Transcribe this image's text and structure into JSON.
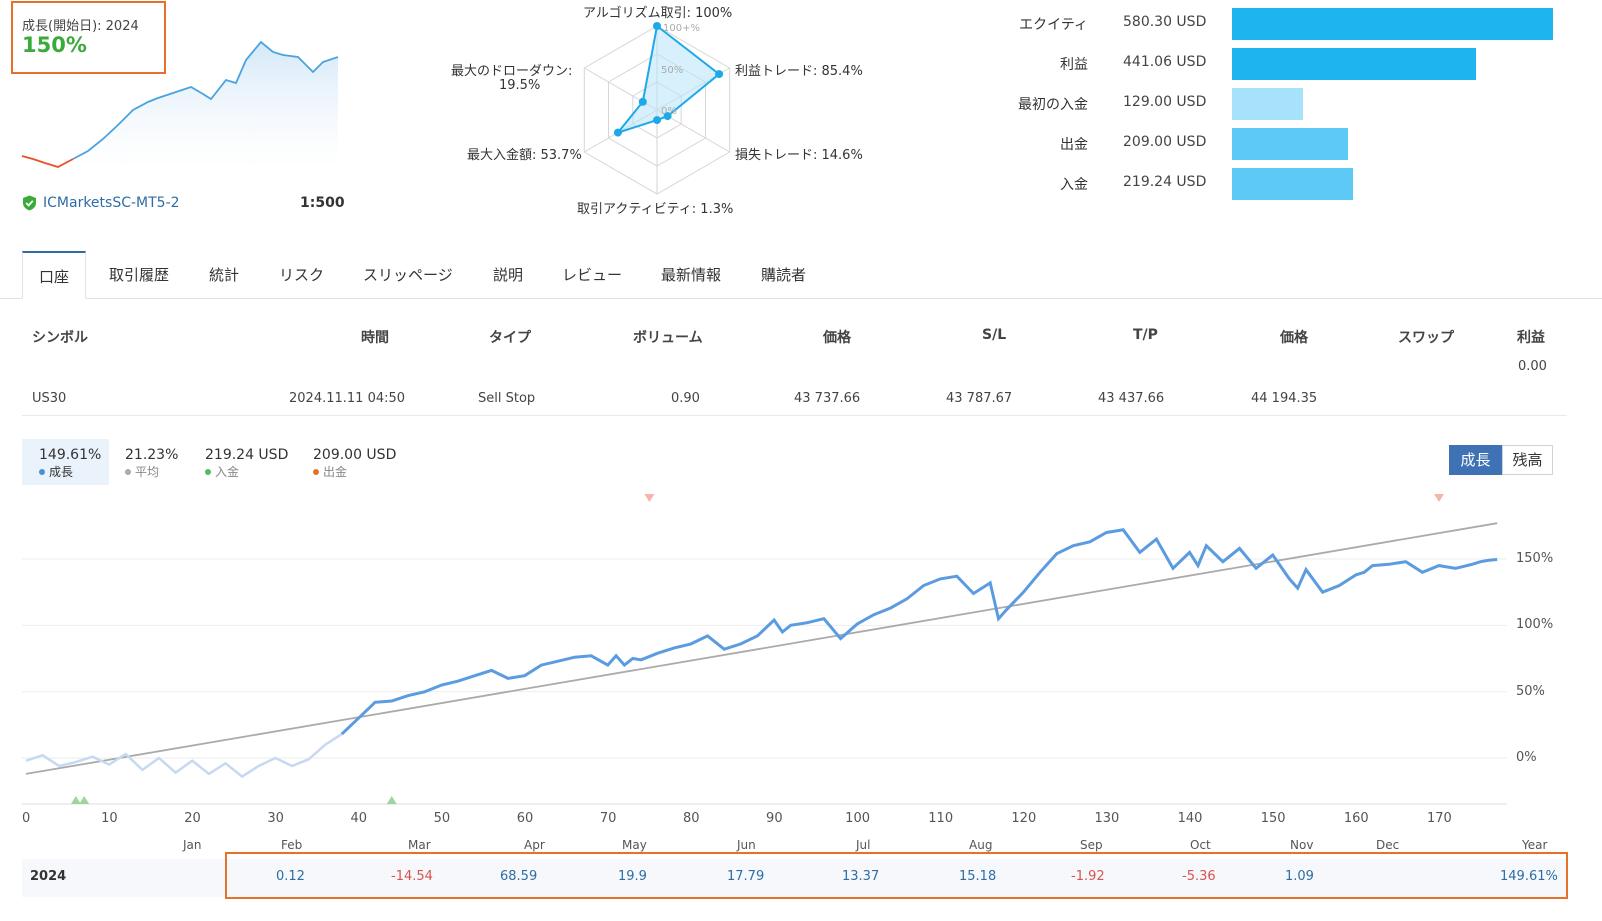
{
  "growth": {
    "label": "成長(開始日): 2024",
    "value": "150%"
  },
  "account": {
    "broker": "ICMarketsSC-MT5-2",
    "leverage": "1:500"
  },
  "radar": {
    "labels": {
      "algo": "アルゴリズム取引: 100%",
      "profit_trades": "利益トレード: 85.4%",
      "loss_trades": "損失トレード: 14.6%",
      "activity": "取引アクティビティ: 1.3%",
      "max_deposit": "最大入金額: 53.7%",
      "drawdown": "最大のドローダウン:",
      "drawdown_value": "19.5%"
    },
    "rings": [
      "100+%",
      "50%",
      "0%"
    ],
    "values": {
      "algo": 100,
      "profit_trades": 85.4,
      "loss_trades": 14.6,
      "activity": 1.3,
      "max_deposit": 53.7,
      "drawdown": 19.5
    }
  },
  "financials": [
    {
      "label": "エクイティ",
      "value": "580.30 USD",
      "amount": 580.3,
      "color": "#1db4ef"
    },
    {
      "label": "利益",
      "value": "441.06 USD",
      "amount": 441.06,
      "color": "#1db4ef"
    },
    {
      "label": "最初の入金",
      "value": "129.00 USD",
      "amount": 129.0,
      "color": "#a6e2f9"
    },
    {
      "label": "出金",
      "value": "209.00 USD",
      "amount": 209.0,
      "color": "#5ccaf4"
    },
    {
      "label": "入金",
      "value": "219.24 USD",
      "amount": 219.24,
      "color": "#5ccaf4"
    }
  ],
  "tabs": [
    "口座",
    "取引履歴",
    "統計",
    "リスク",
    "スリッページ",
    "説明",
    "レビュー",
    "最新情報",
    "購読者"
  ],
  "table": {
    "headers": [
      "シンボル",
      "時間",
      "タイプ",
      "ボリューム",
      "価格",
      "S/L",
      "T/P",
      "価格",
      "スワップ",
      "利益"
    ],
    "total_profit": "0.00",
    "row": [
      "US30",
      "2024.11.11 04:50",
      "Sell Stop",
      "0.90",
      "43 737.66",
      "43 787.67",
      "43 437.66",
      "44 194.35"
    ]
  },
  "legend": [
    {
      "value": "149.61%",
      "label": "成長",
      "color": "#4a90d9"
    },
    {
      "value": "21.23%",
      "label": "平均",
      "color": "#aaaaaa"
    },
    {
      "value": "219.24 USD",
      "label": "入金",
      "color": "#5cb85c"
    },
    {
      "value": "209.00 USD",
      "label": "出金",
      "color": "#e8712a"
    }
  ],
  "toggle": {
    "growth": "成長",
    "balance": "残高"
  },
  "chart_data": {
    "type": "line",
    "x_ticks": [
      0,
      10,
      20,
      30,
      40,
      50,
      60,
      70,
      80,
      90,
      100,
      110,
      120,
      130,
      140,
      150,
      160,
      170
    ],
    "y_ticks": [
      "150%",
      "100%",
      "50%",
      "0%"
    ],
    "xlim": [
      0,
      177
    ],
    "ylim": [
      -35,
      195
    ],
    "growth": {
      "x": [
        0,
        2,
        4,
        6,
        8,
        10,
        12,
        14,
        16,
        18,
        20,
        22,
        24,
        26,
        28,
        30,
        32,
        34,
        36,
        38,
        40,
        42,
        44,
        46,
        48,
        50,
        52,
        54,
        56,
        58,
        60,
        62,
        64,
        66,
        68,
        70,
        71,
        72,
        73,
        74,
        76,
        78,
        80,
        82,
        84,
        86,
        88,
        90,
        91,
        92,
        94,
        96,
        98,
        100,
        102,
        104,
        106,
        108,
        110,
        112,
        114,
        116,
        117,
        118,
        120,
        122,
        124,
        126,
        128,
        130,
        132,
        134,
        136,
        138,
        140,
        141,
        142,
        144,
        146,
        148,
        150,
        152,
        153,
        154,
        156,
        158,
        160,
        161,
        162,
        164,
        166,
        168,
        170,
        172,
        174,
        175,
        176,
        177
      ],
      "y": [
        -2,
        2,
        -6,
        -3,
        1,
        -5,
        3,
        -9,
        0,
        -11,
        -2,
        -12,
        -4,
        -14,
        -6,
        0,
        -6,
        -1,
        10,
        18,
        30,
        42,
        43,
        47,
        50,
        55,
        58,
        62,
        66,
        60,
        62,
        70,
        73,
        76,
        77,
        70,
        77,
        70,
        75,
        74,
        79,
        83,
        86,
        92,
        82,
        86,
        92,
        104,
        95,
        100,
        102,
        105,
        90,
        101,
        108,
        113,
        120,
        130,
        135,
        137,
        124,
        132,
        105,
        112,
        125,
        140,
        154,
        160,
        163,
        170,
        172,
        155,
        165,
        143,
        155,
        145,
        160,
        148,
        158,
        143,
        153,
        135,
        128,
        142,
        125,
        130,
        138,
        140,
        145,
        146,
        148,
        140,
        145,
        143,
        146,
        148,
        149,
        149.61
      ]
    },
    "trend": {
      "x": [
        0,
        177
      ],
      "y": [
        -12,
        177
      ]
    },
    "markers": {
      "withdrawals_x": [
        75,
        170
      ],
      "deposits_x": [
        6,
        7,
        44
      ]
    }
  },
  "months": [
    "Jan",
    "Feb",
    "Mar",
    "Apr",
    "May",
    "Jun",
    "Jul",
    "Aug",
    "Sep",
    "Oct",
    "Nov",
    "Dec",
    "Year"
  ],
  "year_row": {
    "year": "2024",
    "values": [
      "",
      "0.12",
      "-14.54",
      "68.59",
      "19.9",
      "17.79",
      "13.37",
      "15.18",
      "-1.92",
      "-5.36",
      "1.09",
      "",
      "149.61%"
    ],
    "signs": [
      "",
      "pos",
      "neg",
      "pos",
      "pos",
      "pos",
      "pos",
      "pos",
      "neg",
      "neg",
      "pos",
      "",
      "pos"
    ]
  }
}
